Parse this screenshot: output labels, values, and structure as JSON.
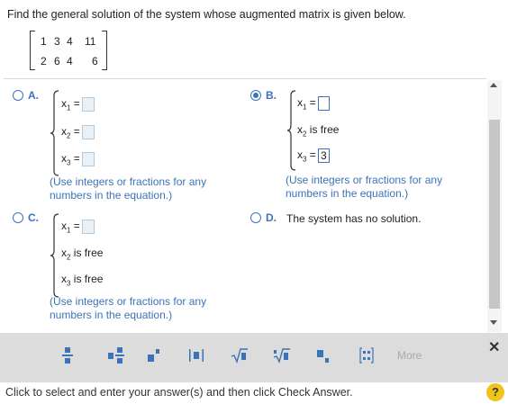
{
  "question": "Find the general solution of the system whose augmented matrix is given below.",
  "matrix": {
    "row1": [
      "1",
      "3",
      "4",
      "11"
    ],
    "row2": [
      "2",
      "6",
      "4",
      "6"
    ]
  },
  "options": {
    "A": {
      "letter": "A.",
      "lines": [
        "x1 =",
        "x2 =",
        "x3 ="
      ],
      "hint": "(Use integers or fractions for any numbers in the equation.)"
    },
    "B": {
      "letter": "B.",
      "line1": "x1 =",
      "line2": "x2 is free",
      "line3": "x3 =",
      "x3_value": "3",
      "hint": "(Use integers or fractions for any numbers in the equation.)",
      "selected": true
    },
    "C": {
      "letter": "C.",
      "line1": "x1 =",
      "line2": "x2 is free",
      "line3": "x3 is free",
      "hint": "(Use integers or fractions for any numbers in the equation.)"
    },
    "D": {
      "letter": "D.",
      "text": "The system has no solution."
    }
  },
  "toolbar": {
    "more_label": "More",
    "close_label": "✕"
  },
  "status": "Click to select and enter your answer(s) and then click Check Answer.",
  "help_label": "?",
  "colors": {
    "accent": "#3b73b9",
    "toolbar_bg": "#dcdcdc",
    "help": "#f0c419"
  }
}
